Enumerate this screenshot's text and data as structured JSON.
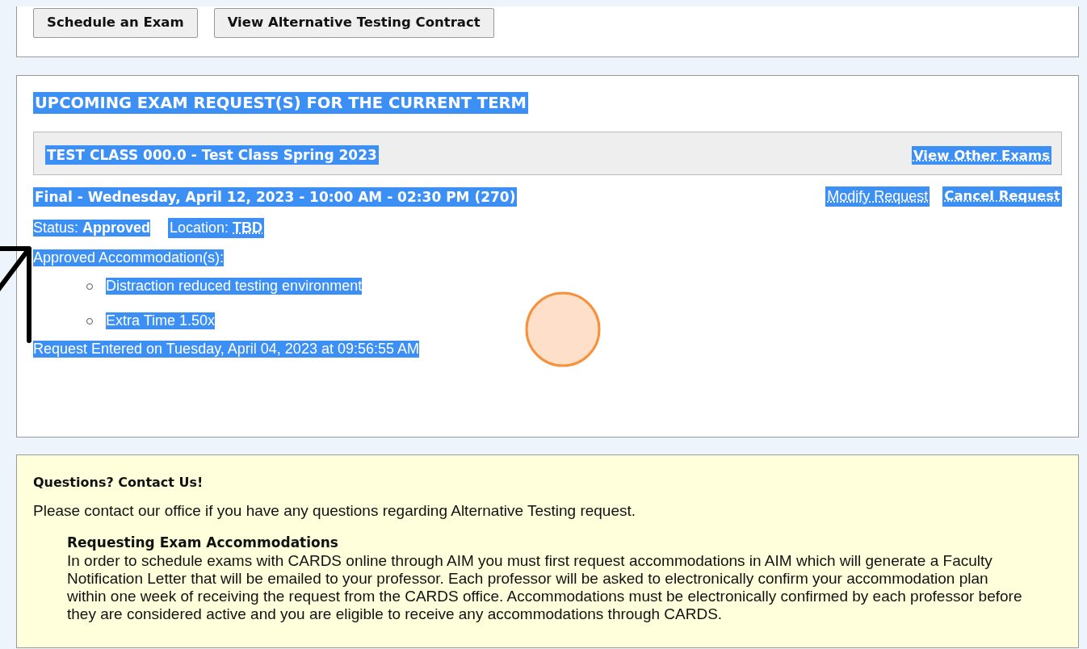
{
  "actions": [
    {
      "label": "Schedule an Exam"
    },
    {
      "label": "View Alternative Testing Contract"
    }
  ],
  "text_highlighted": true,
  "upcoming": {
    "heading": "UPCOMING EXAM REQUEST(S) FOR THE CURRENT TERM",
    "class_title": "TEST CLASS 000.0 - Test Class Spring 2023",
    "view_other_link": "View Other Exams",
    "exam": {
      "title": "Final - Wednesday, April 12, 2023 - 10:00 AM - 02:30 PM (270)",
      "links": [
        "Modify Request",
        "Cancel Request"
      ],
      "status": "Status: **Approved**",
      "location_label": "Location:",
      "location": "TBD",
      "accommodations_label": "Approved Accommodation(s):",
      "accommodations": [
        "Distraction reduced testing environment",
        "Extra Time 1.50x"
      ],
      "entered": "Request Entered on Tuesday, April 04, 2023 at 09:56:55 AM"
    }
  },
  "contact": {
    "title": "Questions? Contact Us!",
    "intro": "Please contact our office if you have any questions regarding Alternative Testing request.",
    "section_title": "Requesting Exam Accommodations",
    "section_text": "In order to schedule exams with CARDS online through AIM you must first request accommodations in AIM which will generate a Faculty Notification Letter that will be emailed to your professor. Each professor will be asked to electronically confirm your accommodation plan within one week of receiving the request from the CARDS office. Accommodations must be electronically confirmed by each professor before they are considered active and you are eligible to receive any accommodations through CARDS."
  }
}
